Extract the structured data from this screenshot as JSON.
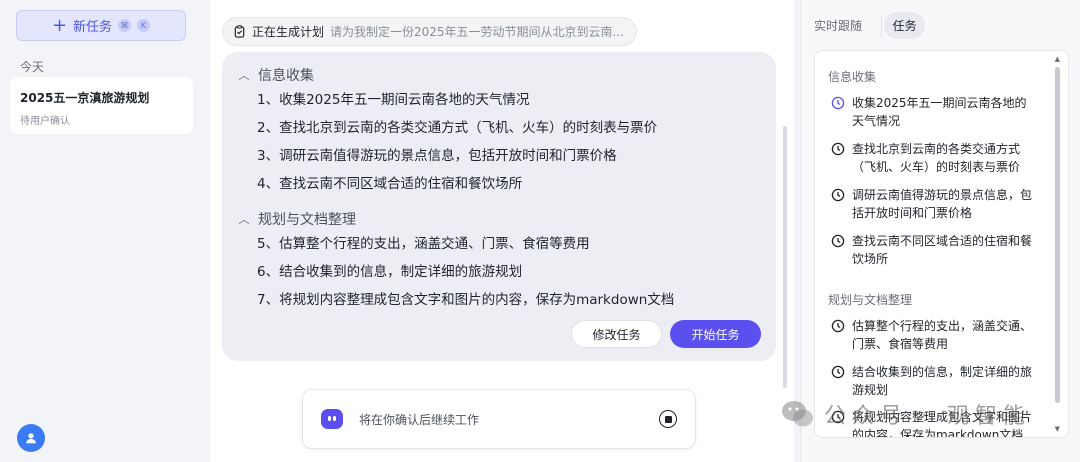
{
  "sidebar": {
    "new_task_label": "新任务",
    "shortcut_keys": [
      "⌘",
      "K"
    ],
    "section_today": "今天",
    "session": {
      "title": "2025五一京滇旅游规划",
      "status": "待用户确认"
    }
  },
  "main": {
    "generating_label": "正在生成计划",
    "query_preview": "请为我制定一份2025年五一劳动节期间从北京到云南...",
    "groups": [
      {
        "title": "信息收集",
        "items": [
          "1、收集2025年五一期间云南各地的天气情况",
          "2、查找北京到云南的各类交通方式（飞机、火车）的时刻表与票价",
          "3、调研云南值得游玩的景点信息，包括开放时间和门票价格",
          "4、查找云南不同区域合适的住宿和餐饮场所"
        ]
      },
      {
        "title": "规划与文档整理",
        "items": [
          "5、估算整个行程的支出，涵盖交通、门票、食宿等费用",
          "6、结合收集到的信息，制定详细的旅游规划",
          "7、将规划内容整理成包含文字和图片的内容，保存为markdown文档"
        ]
      }
    ],
    "edit_button": "修改任务",
    "start_button": "开始任务",
    "input_text": "将在你确认后继续工作"
  },
  "right": {
    "tab_live": "实时跟随",
    "tab_task": "任务",
    "groups": [
      {
        "title": "信息收集",
        "items": [
          "收集2025年五一期间云南各地的天气情况",
          "查找北京到云南的各类交通方式（飞机、火车）的时刻表与票价",
          "调研云南值得游玩的景点信息，包括开放时间和门票价格",
          "查找云南不同区域合适的住宿和餐饮场所"
        ]
      },
      {
        "title": "规划与文档整理",
        "items": [
          "估算整个行程的支出，涵盖交通、门票、食宿等费用",
          "结合收集到的信息，制定详细的旅游规划",
          "将规划内容整理成包含文字和图片的内容，保存为markdown文档"
        ]
      }
    ]
  },
  "watermark": "公众号 · 观智能",
  "colors": {
    "accent": "#5b4ff0",
    "new_task_bg": "#e3e6fd",
    "plan_card_bg": "#eceef4",
    "avatar": "#3b7cf4"
  }
}
